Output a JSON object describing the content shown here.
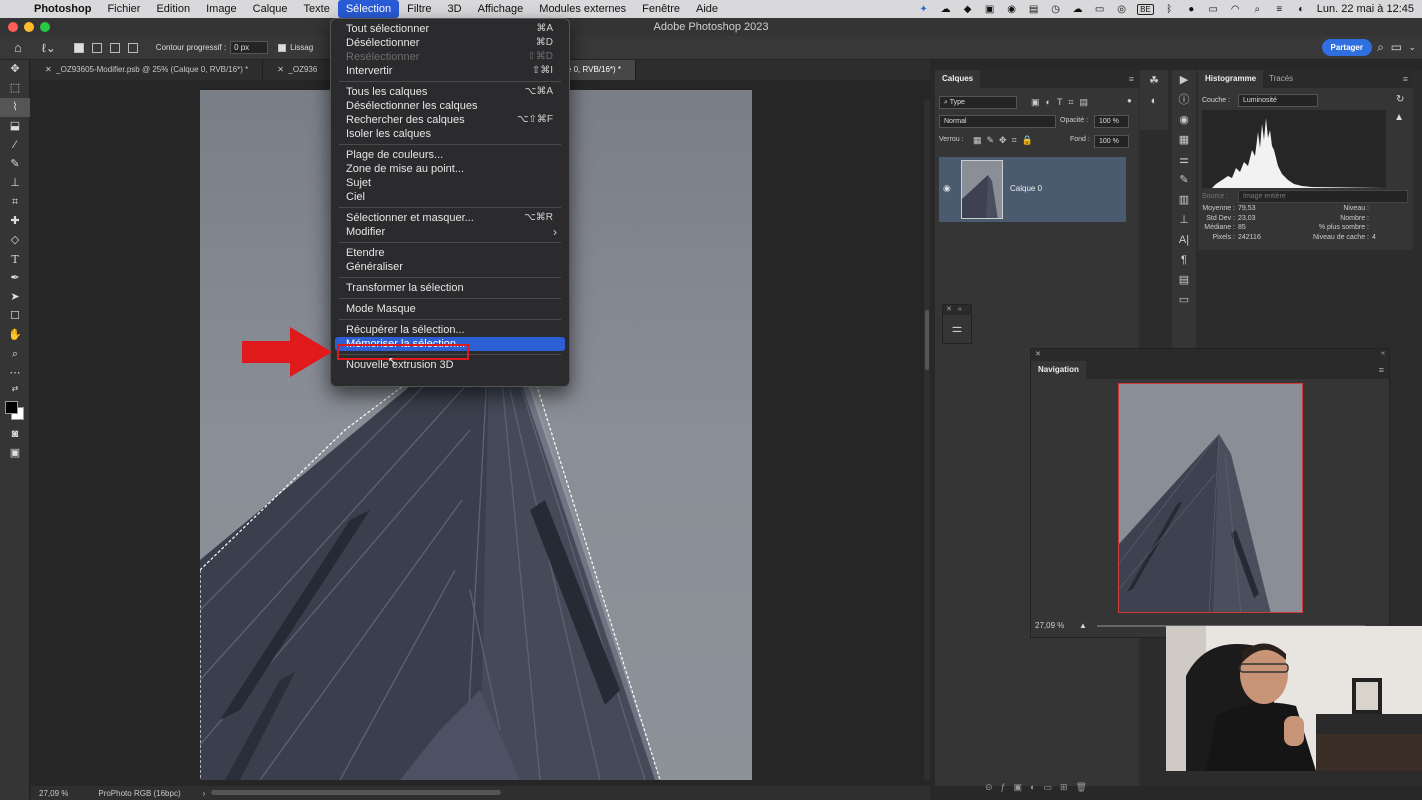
{
  "menubar": {
    "app": "Photoshop",
    "items": [
      "Fichier",
      "Edition",
      "Image",
      "Calque",
      "Texte",
      "Sélection",
      "Filtre",
      "3D",
      "Affichage",
      "Modules externes",
      "Fenêtre",
      "Aide"
    ],
    "active": "Sélection",
    "keyboard_layout": "BE",
    "clock": "Lun. 22 mai à 12:45"
  },
  "window": {
    "title": "Adobe Photoshop 2023"
  },
  "options": {
    "feather_label": "Contour progressif :",
    "feather_value": "0 px",
    "smooth_label": "Lissag",
    "share_label": "Partager"
  },
  "tabs": [
    {
      "label": "_OZ93605-Modifier.psb @ 25% (Calque 0, RVB/16*) *"
    },
    {
      "label": "_OZ936"
    },
    {
      "label": "OZ93605.NEF @ 27,1% (Calque 0, RVB/16*) *"
    }
  ],
  "selection_menu": {
    "items": [
      {
        "label": "Tout sélectionner",
        "shortcut": "⌘A"
      },
      {
        "label": "Désélectionner",
        "shortcut": "⌘D"
      },
      {
        "label": "Resélectionner",
        "shortcut": "⇧⌘D",
        "disabled": true
      },
      {
        "label": "Intervertir",
        "shortcut": "⇧⌘I"
      },
      {
        "label": "Tous les calques",
        "shortcut": "⌥⌘A"
      },
      {
        "label": "Désélectionner les calques",
        "shortcut": ""
      },
      {
        "label": "Rechercher des calques",
        "shortcut": "⌥⇧⌘F"
      },
      {
        "label": "Isoler les calques",
        "shortcut": ""
      },
      {
        "label": "Plage de couleurs...",
        "shortcut": ""
      },
      {
        "label": "Zone de mise au point...",
        "shortcut": ""
      },
      {
        "label": "Sujet",
        "shortcut": ""
      },
      {
        "label": "Ciel",
        "shortcut": ""
      },
      {
        "label": "Sélectionner et masquer...",
        "shortcut": "⌥⌘R"
      },
      {
        "label": "Modifier",
        "shortcut": "›"
      },
      {
        "label": "Etendre",
        "shortcut": ""
      },
      {
        "label": "Généraliser",
        "shortcut": ""
      },
      {
        "label": "Transformer la sélection",
        "shortcut": ""
      },
      {
        "label": "Mode Masque",
        "shortcut": ""
      },
      {
        "label": "Récupérer la sélection...",
        "shortcut": ""
      },
      {
        "label": "Mémoriser la sélection...",
        "shortcut": "",
        "highlighted": true
      },
      {
        "label": "Nouvelle extrusion 3D",
        "shortcut": ""
      }
    ]
  },
  "layers_panel": {
    "title": "Calques",
    "filter": "Type",
    "blend_mode": "Normal",
    "opacity_label": "Opacité :",
    "opacity": "100 %",
    "lock_label": "Verrou :",
    "fill_label": "Fond :",
    "fill": "100 %",
    "layer_name": "Calque 0"
  },
  "histogram": {
    "tab": "Histogramme",
    "tab2": "Tracés",
    "channel_label": "Couche :",
    "channel": "Luminosité",
    "source_label": "Source :",
    "source": "Image entière",
    "stats": {
      "mean_label": "Moyenne :",
      "mean": "79,53",
      "std_label": "Std Dev :",
      "std": "23,03",
      "median_label": "Médiane :",
      "median": "85",
      "pixels_label": "Pixels :",
      "pixels": "242116",
      "level_label": "Niveau :",
      "count_label": "Nombre :",
      "darker_label": "% plus sombre :",
      "cache_label": "Niveau de cache :",
      "cache": "4"
    }
  },
  "navigator": {
    "title": "Navigation",
    "zoom": "27,09 %"
  },
  "status": {
    "zoom": "27,09 %",
    "profile": "ProPhoto RGB (16bpc)"
  },
  "colors": {
    "accent": "#2d5fd4",
    "annotation_red": "#e01a1a",
    "share_button": "#2f6fe0"
  }
}
